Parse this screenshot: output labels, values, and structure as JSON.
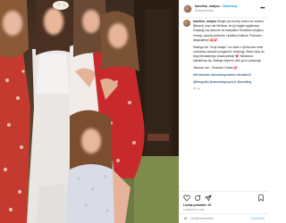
{
  "post": {
    "username": "karolina_malysz",
    "follow_label": "Obserwuj",
    "subtitle": "Świętochowice",
    "more_label": "•••",
    "caption": {
      "paragraphs": [
        "Minęło już trochę czasu od wesela @kamil_czyz ale Melissa, że jej ciągle wyjątkowy. Dziękuję raz jeszcze za wszystko! Mnóstwo ciepłych emocji, pyszne jedzenie i świetna kultura. Polecam i dziękujemy! 🥰💕",
        "Dlatego też \"moje święto\" na czele z @risa dla mnie czołówką naszych przyjaciół i dziękuję. Masz rękę do tego biesiadnego towarzystwa! 💗 Niedawno staraliśmy się, dlatego dopiero dziś go tu pokazuję.",
        "Jeszcze raz - Gracias! Chicas 💕",
        "#tbt #wesele #weselnegosiedne #femaleDJ",
        "@fotografia @weselnegospot.pl @wedding"
      ],
      "time": "80 tyg."
    },
    "likes": "Liczba polubień: 91",
    "date": "2 SIERPNIA 2020",
    "comment_placeholder": "Dodaj komentarz...",
    "publish_label": "Opublikuj",
    "emoji_icon": "smiley-icon"
  },
  "colors": {
    "accent": "#0095f6",
    "muted": "#8e8e8e",
    "text": "#262626",
    "border": "#efefef"
  }
}
